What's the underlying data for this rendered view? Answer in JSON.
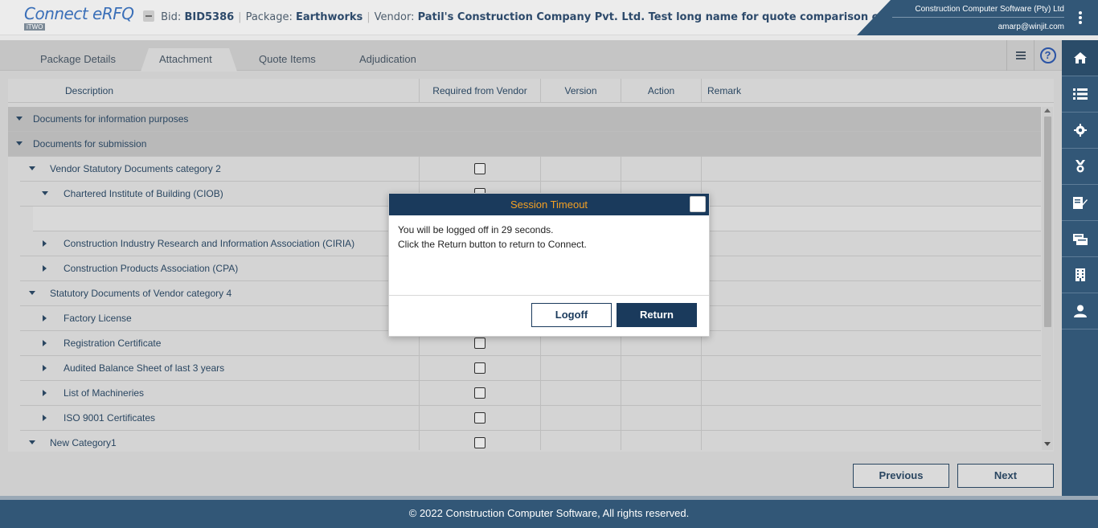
{
  "header": {
    "logo_text": "Connect eRFQ",
    "logo_sub": "iTWO",
    "bid_label": "Bid:",
    "bid_value": "BID5386",
    "package_label": "Package:",
    "package_value": "Earthworks",
    "vendor_label": "Vendor:",
    "vendor_value": "Patil's Construction Company Pvt. Ltd. Test long name for quote comparison column width",
    "company": "Construction Computer Software (Pty) Ltd",
    "email": "amarp@winjit.com"
  },
  "tabs": [
    {
      "label": "Package Details"
    },
    {
      "label": "Attachment"
    },
    {
      "label": "Quote Items"
    },
    {
      "label": "Adjudication"
    }
  ],
  "grid": {
    "columns": [
      "Description",
      "Required from Vendor",
      "Version",
      "Action",
      "Remark"
    ],
    "rows": [
      {
        "label": "Documents for information purposes"
      },
      {
        "label": "Documents for submission"
      },
      {
        "label": "Vendor Statutory Documents category 2"
      },
      {
        "label": "Chartered Institute of Building (CIOB)"
      },
      {
        "label": "Construction Industry Research and Information Association (CIRIA)"
      },
      {
        "label": "Construction Products Association (CPA)"
      },
      {
        "label": "Statutory Documents of Vendor category 4"
      },
      {
        "label": "Factory License"
      },
      {
        "label": "Registration Certificate"
      },
      {
        "label": "Audited Balance Sheet of last 3 years"
      },
      {
        "label": "List of Machineries"
      },
      {
        "label": "ISO 9001 Certificates"
      },
      {
        "label": "New Category1"
      }
    ]
  },
  "nav": {
    "previous": "Previous",
    "next": "Next"
  },
  "footer": {
    "text": "© 2022 Construction Computer Software, All rights reserved."
  },
  "dialog": {
    "title": "Session Timeout",
    "line1": "You will be logged off in 29 seconds.",
    "line2": "Click the Return button to return to Connect.",
    "logoff": "Logoff",
    "return": "Return"
  },
  "sidebar_icons": [
    "home-icon",
    "list-icon",
    "gear-icon",
    "award-icon",
    "sign-document-icon",
    "quote-icon",
    "building-icon",
    "user-icon"
  ],
  "colors": {
    "primary": "#325777",
    "dialog_header": "#1a3a5c",
    "dialog_title": "#f4a023"
  }
}
